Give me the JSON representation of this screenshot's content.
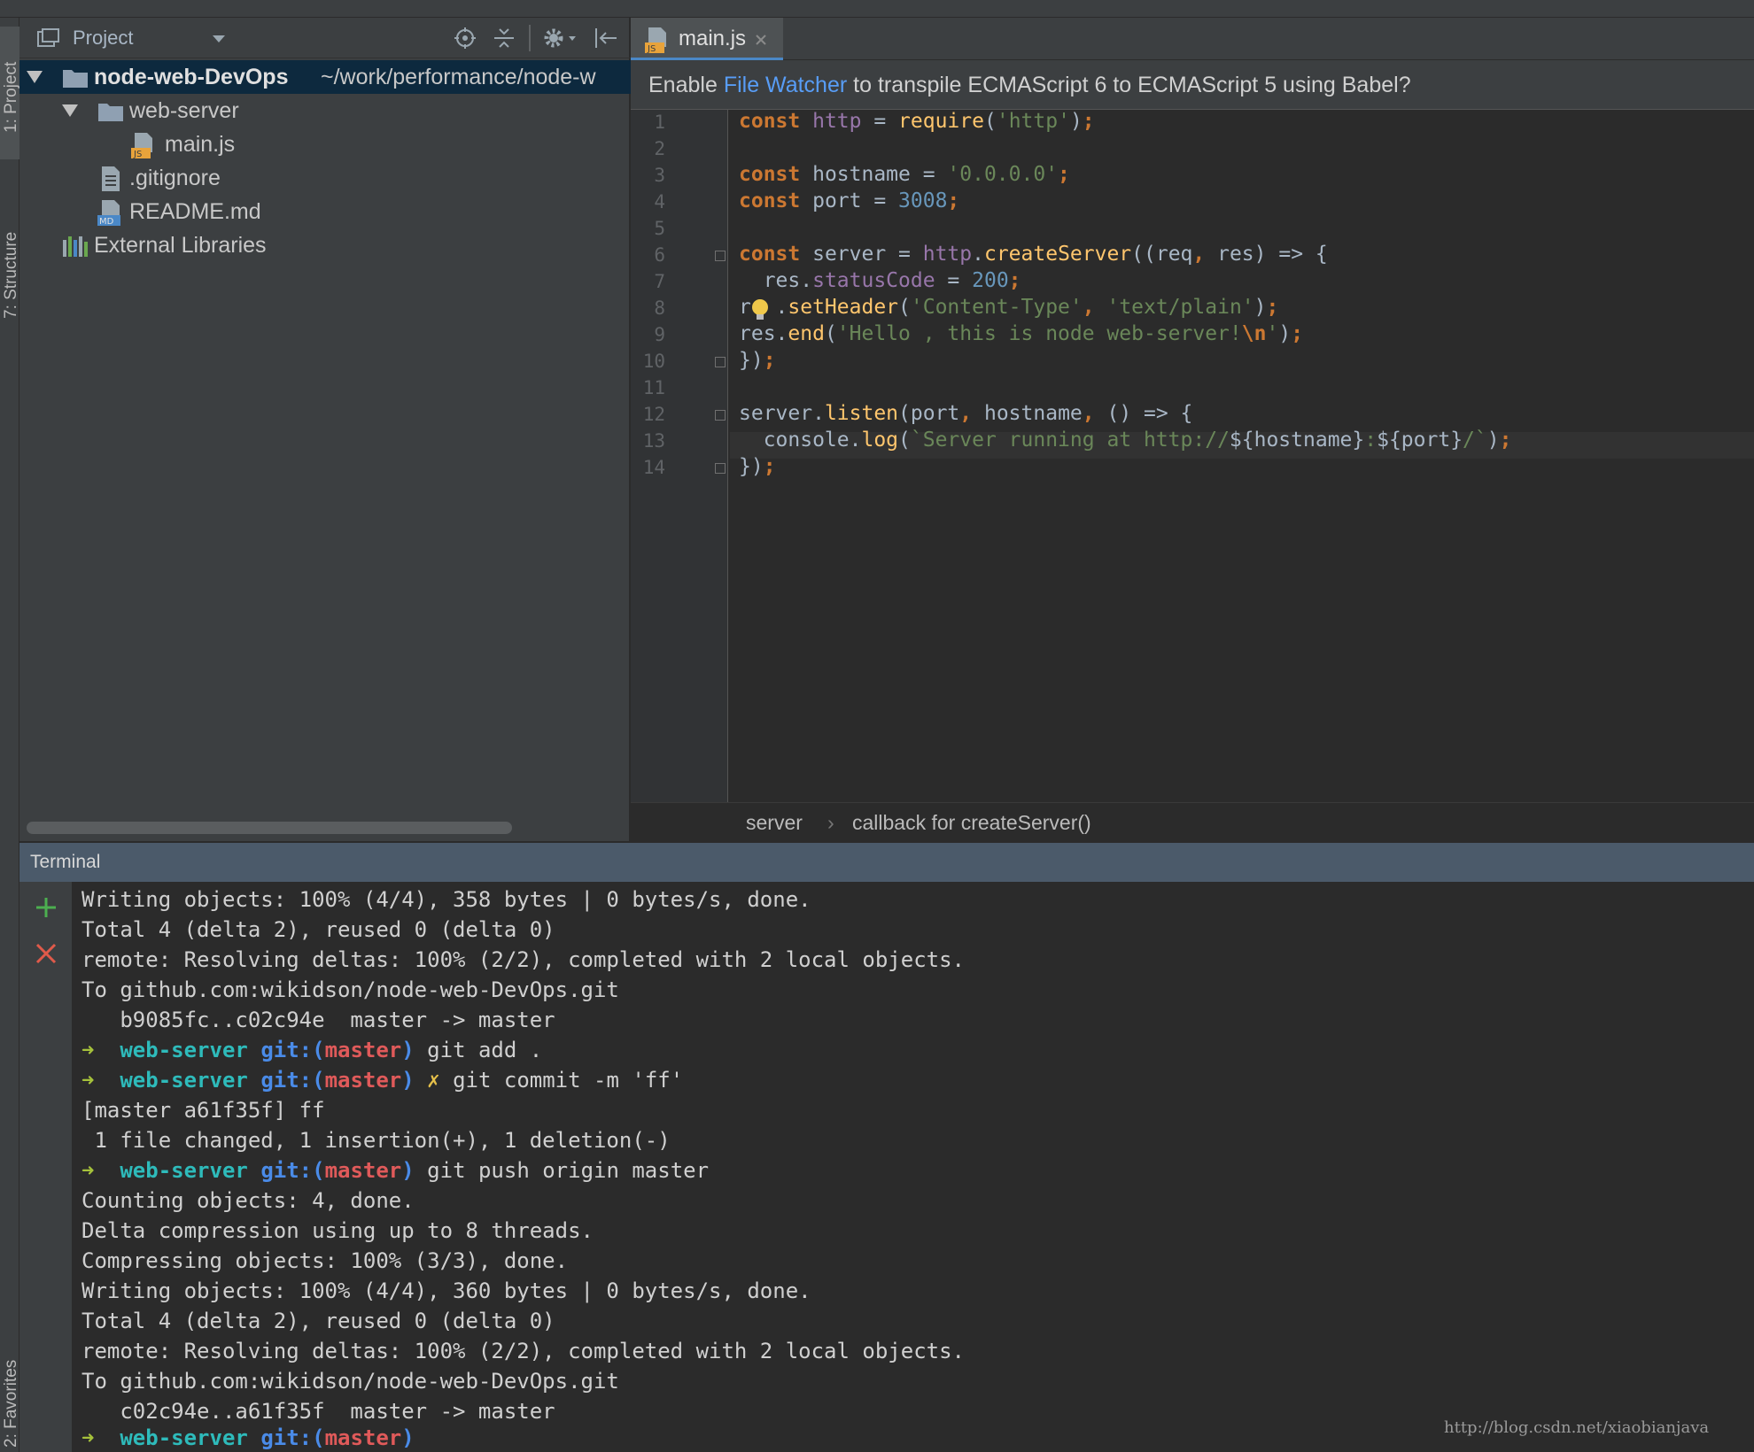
{
  "side_tabs": {
    "project": "1: Project",
    "structure": "7: Structure",
    "favorites": "2: Favorites"
  },
  "project_panel": {
    "title": "Project",
    "tree": [
      {
        "label": "node-web-DevOps",
        "path": "~/work/performance/node-w",
        "icon": "folder-icon",
        "expanded": true,
        "depth": 0
      },
      {
        "label": "web-server",
        "icon": "folder-icon",
        "expanded": true,
        "depth": 1
      },
      {
        "label": "main.js",
        "icon": "js-file-icon",
        "depth": 2
      },
      {
        "label": ".gitignore",
        "icon": "text-file-icon",
        "depth": 1
      },
      {
        "label": "README.md",
        "icon": "md-file-icon",
        "depth": 1
      },
      {
        "label": "External Libraries",
        "icon": "library-icon",
        "depth": 0
      }
    ]
  },
  "editor": {
    "tab": {
      "label": "main.js",
      "icon": "js-file-icon"
    },
    "banner": {
      "prefix": "Enable",
      "link": "File Watcher",
      "suffix": "to transpile ECMAScript 6 to ECMAScript 5 using Babel?"
    },
    "line_numbers": [
      "1",
      "2",
      "3",
      "4",
      "5",
      "6",
      "7",
      "8",
      "9",
      "10",
      "11",
      "12",
      "13",
      "14"
    ],
    "breadcrumbs": [
      "server",
      "callback for createServer()"
    ]
  },
  "terminal": {
    "title": "Terminal",
    "prompt_dir": "web-server",
    "prompt_git": "git:(",
    "prompt_branch": "master",
    "prompt_close": ")",
    "lines": [
      "Writing objects: 100% (4/4), 358 bytes | 0 bytes/s, done.",
      "Total 4 (delta 2), reused 0 (delta 0)",
      "remote: Resolving deltas: 100% (2/2), completed with 2 local objects.",
      "To github.com:wikidson/node-web-DevOps.git",
      "   b9085fc..c02c94e  master -> master",
      "git add .",
      "git commit -m 'ff'",
      "[master a61f35f] ff",
      " 1 file changed, 1 insertion(+), 1 deletion(-)",
      "git push origin master",
      "Counting objects: 4, done.",
      "Delta compression using up to 8 threads.",
      "Compressing objects: 100% (3/3), done.",
      "Writing objects: 100% (4/4), 360 bytes | 0 bytes/s, done.",
      "Total 4 (delta 2), reused 0 (delta 0)",
      "remote: Resolving deltas: 100% (2/2), completed with 2 local objects.",
      "To github.com:wikidson/node-web-DevOps.git",
      "   c02c94e..a61f35f  master -> master"
    ]
  },
  "watermark": "http://blog.csdn.net/xiaobianjava",
  "colors": {
    "accent": "#4a88c7",
    "keyword": "#cc7832",
    "string": "#6a8759",
    "number": "#6897bb",
    "function": "#ffc66d"
  }
}
